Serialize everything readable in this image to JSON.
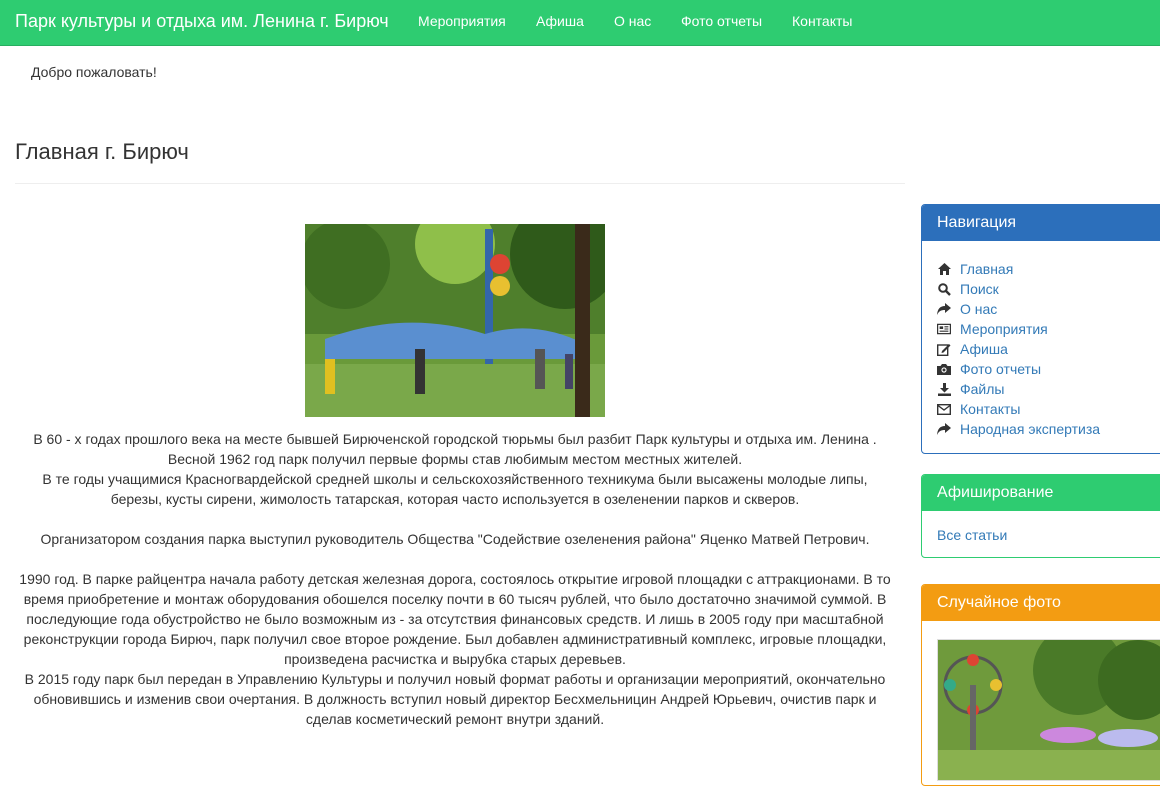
{
  "navbar": {
    "brand": "Парк культуры и отдыха им. Ленина г. Бирюч",
    "links": [
      "Мероприятия",
      "Афиша",
      "О нас",
      "Фото отчеты",
      "Контакты"
    ]
  },
  "welcome": "Добро пожаловать!",
  "page_title": "Главная г. Бирюч",
  "article": {
    "paragraphs": [
      [
        "В 60 - х годах прошлого века на месте бывшей Бирюченской городской тюрьмы был разбит Парк культуры и отдыха им. Ленина .",
        "Весной 1962 год парк получил первые формы став  любимым местом местных жителей.",
        "В те годы учащимися Красногвардейской средней школы и сельскохозяйственного техникума были высажены молодые липы,",
        "березы, кусты сирени, жимолость татарская, которая  часто используется в озеленении парков и скверов."
      ],
      [
        "Организатором создания парка выступил  руководитель Общества \"Содействие озеленения района\" Яценко Матвей Петрович."
      ],
      [
        "1990 год. В парке райцентра начала работу детская железная дорога, состоялось открытие игровой площадки с аттракционами. В то",
        "время приобретение и монтаж оборудования обошелся поселку почти в 60 тысяч рублей, что было достаточно значимой суммой. В",
        "последующие года обустройство не было возможным из - за отсутствия финансовых средств. И лишь в 2005 году при масштабной",
        "реконструкции города Бирюч, парк получил свое второе рождение. Был добавлен административный комплекс, игровые площадки,",
        "произведена расчистка и вырубка старых деревьев.",
        "В 2015 году парк был передан в Управлению Культуры и получил новый формат работы и организации мероприятий, окончательно",
        "обновившись и изменив свои очертания. В должность вступил новый директор Бесхмельницин Андрей Юрьевич, очистив парк и",
        "сделав косметический ремонт внутри зданий."
      ]
    ]
  },
  "sidebar": {
    "navigation": {
      "title": "Навигация",
      "color": "#2c6fbb",
      "items": [
        {
          "label": "Главная",
          "icon": "home-icon"
        },
        {
          "label": "Поиск",
          "icon": "search-icon"
        },
        {
          "label": "О нас",
          "icon": "share-arrow-icon"
        },
        {
          "label": "Мероприятия",
          "icon": "newspaper-icon"
        },
        {
          "label": "Афиша",
          "icon": "edit-icon"
        },
        {
          "label": "Фото отчеты",
          "icon": "camera-icon"
        },
        {
          "label": "Файлы",
          "icon": "download-icon"
        },
        {
          "label": "Контакты",
          "icon": "envelope-icon"
        },
        {
          "label": "Народная экспертиза",
          "icon": "share-arrow-icon"
        }
      ]
    },
    "afisha": {
      "title": "Афиширование",
      "color": "#2ecc71",
      "link": "Все статьи"
    },
    "random_photo": {
      "title": "Случайное фото",
      "color": "#f39c12"
    }
  },
  "colors": {
    "navbar": "#2ecc71",
    "link": "#337ab7",
    "text": "#333333"
  }
}
